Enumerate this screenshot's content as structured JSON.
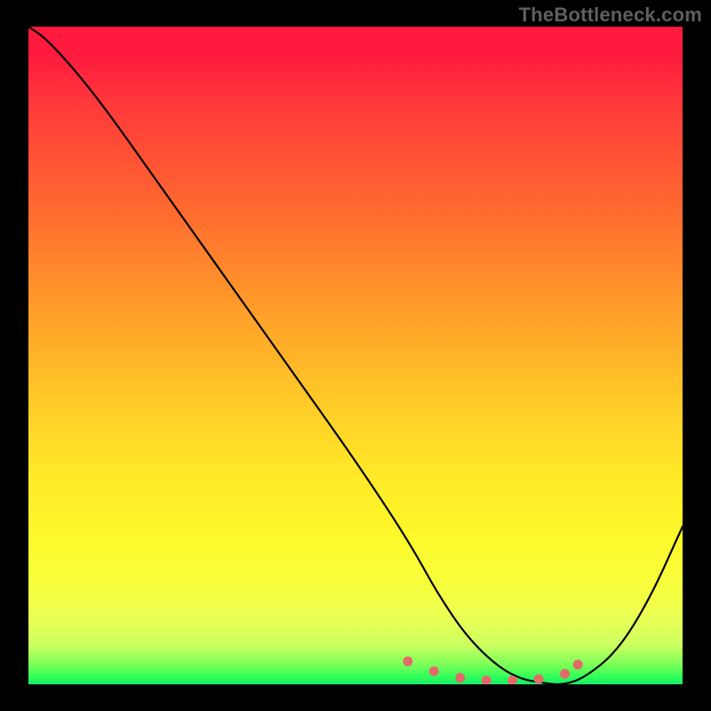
{
  "watermark": "TheBottleneck.com",
  "chart_data": {
    "type": "line",
    "title": "",
    "xlabel": "",
    "ylabel": "",
    "xlim": [
      0,
      100
    ],
    "ylim": [
      0,
      100
    ],
    "grid": false,
    "series": [
      {
        "name": "curve",
        "x": [
          0,
          3,
          10,
          20,
          30,
          40,
          50,
          58,
          63,
          68,
          74,
          80,
          82,
          85,
          90,
          95,
          100
        ],
        "values": [
          100,
          98,
          90,
          76,
          62,
          48,
          34,
          22,
          13,
          6,
          1,
          0,
          0,
          1,
          5,
          13,
          24
        ]
      }
    ],
    "markers": {
      "name": "valley-markers",
      "color": "#e46a6a",
      "points": [
        {
          "x": 58,
          "y": 3.5
        },
        {
          "x": 62,
          "y": 2.0
        },
        {
          "x": 66,
          "y": 1.0
        },
        {
          "x": 70,
          "y": 0.6
        },
        {
          "x": 74,
          "y": 0.6
        },
        {
          "x": 78,
          "y": 0.8
        },
        {
          "x": 82,
          "y": 1.6
        },
        {
          "x": 84,
          "y": 3.0
        }
      ]
    },
    "background_gradient": {
      "top": "#ff1a3e",
      "mid": "#ffe927",
      "bottom": "#18e86a"
    }
  }
}
